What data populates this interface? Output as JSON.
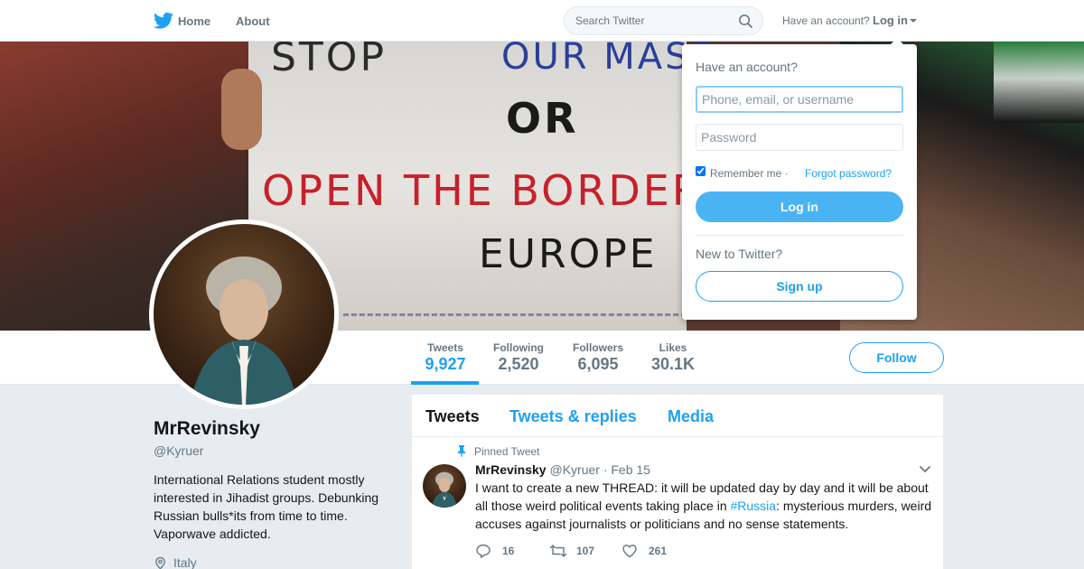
{
  "nav": {
    "home_label": "Home",
    "about_label": "About",
    "search_placeholder": "Search Twitter",
    "have_account": "Have an account?",
    "login_label": "Log in"
  },
  "banner": {
    "sign_line1": "STOP",
    "sign_line1b": "OUR MASS",
    "sign_line2": "OR",
    "sign_line3": "OPEN THE BORDERS",
    "sign_line4": "EUROPE"
  },
  "stats": [
    {
      "label": "Tweets",
      "value": "9,927",
      "active": true
    },
    {
      "label": "Following",
      "value": "2,520"
    },
    {
      "label": "Followers",
      "value": "6,095"
    },
    {
      "label": "Likes",
      "value": "30.1K"
    }
  ],
  "follow_label": "Follow",
  "profile": {
    "name": "MrRevinsky",
    "handle": "@Kyruer",
    "bio": "International Relations student mostly interested in Jihadist groups. Debunking Russian bulls*its from time to time. Vaporwave addicted.",
    "location": "Italy"
  },
  "timeline": {
    "tabs": [
      "Tweets",
      "Tweets & replies",
      "Media"
    ],
    "pinned_label": "Pinned Tweet",
    "tweet": {
      "name": "MrRevinsky",
      "handle": "@Kyruer",
      "date": "· Feb 15",
      "text_before": "I want to create a new THREAD: it will be updated day by day and it will be about all those weird political events taking place in ",
      "hashtag": "#Russia",
      "text_after": ": mysterious murders, weird accuses against journalists or politicians and no sense statements.",
      "replies": "16",
      "retweets": "107",
      "likes": "261"
    }
  },
  "login_dropdown": {
    "heading": "Have an account?",
    "username_placeholder": "Phone, email, or username",
    "password_placeholder": "Password",
    "remember_label": "Remember me ·",
    "forgot_label": "Forgot password?",
    "login_button": "Log in",
    "new_label": "New to Twitter?",
    "signup_button": "Sign up"
  },
  "colors": {
    "accent": "#1da1f2",
    "login_button": "#4ab3f4",
    "page_bg": "#e6ecf0",
    "muted_text": "#657786"
  },
  "icons": {
    "logo": "twitter-bird-icon",
    "search": "search-icon",
    "location": "location-pin-icon",
    "pin": "pin-icon",
    "reply": "reply-icon",
    "retweet": "retweet-icon",
    "like": "heart-icon"
  }
}
